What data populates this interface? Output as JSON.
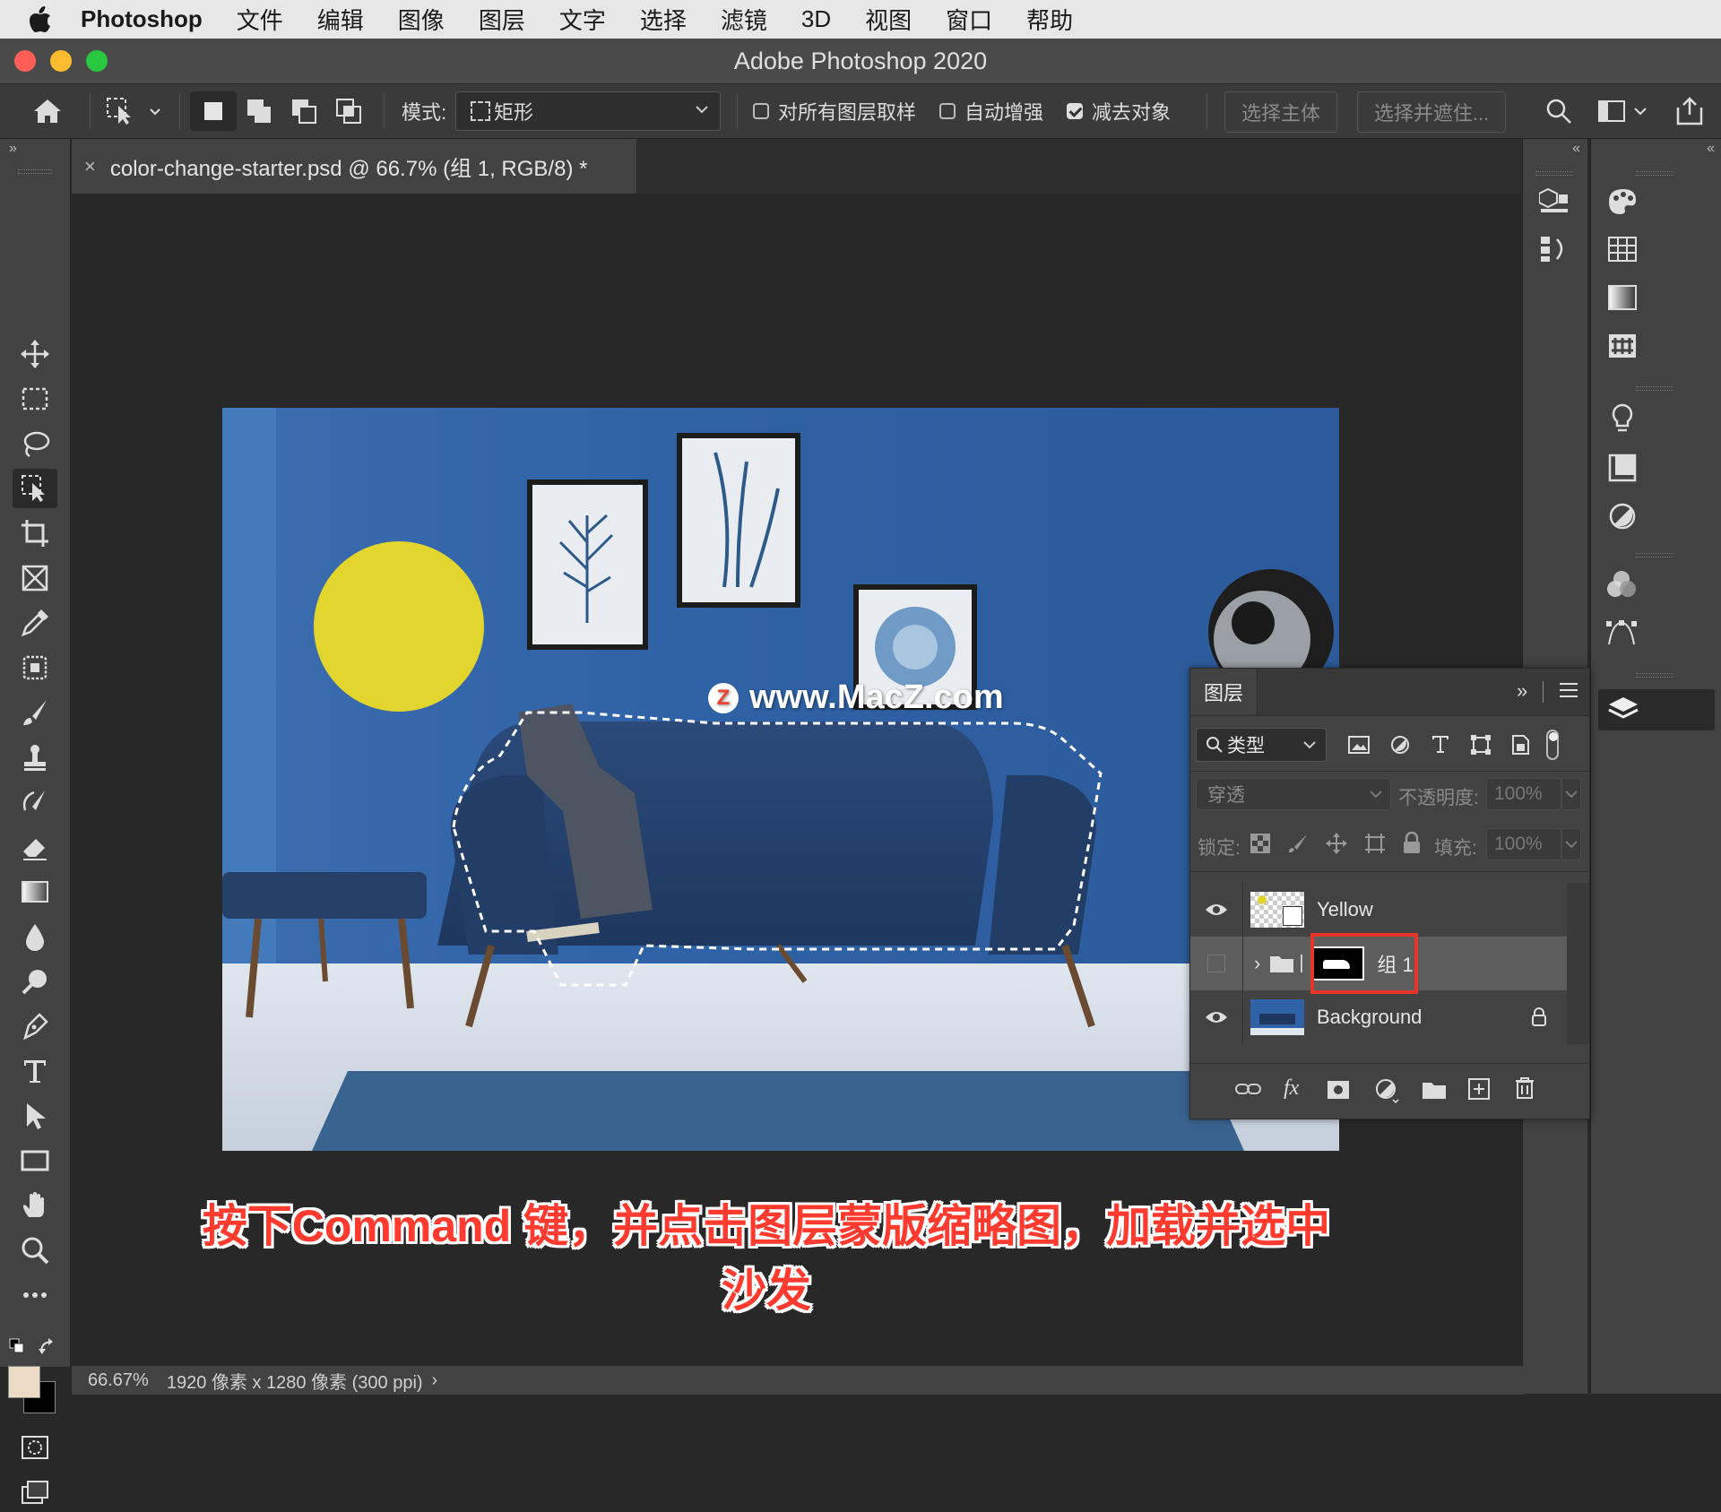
{
  "menubar": {
    "app_name": "Photoshop",
    "items": [
      "文件",
      "编辑",
      "图像",
      "图层",
      "文字",
      "选择",
      "滤镜",
      "3D",
      "视图",
      "窗口",
      "帮助"
    ]
  },
  "window": {
    "title": "Adobe Photoshop 2020"
  },
  "options_bar": {
    "mode_label": "模式:",
    "mode_value": "矩形",
    "sample_all_layers": "对所有图层取样",
    "sample_all_layers_checked": false,
    "auto_enhance": "自动增强",
    "auto_enhance_checked": false,
    "subtract_object": "减去对象",
    "subtract_object_checked": true,
    "select_subject": "选择主体",
    "select_and_mask": "选择并遮住..."
  },
  "document_tab": {
    "close": "×",
    "title": "color-change-starter.psd @ 66.7% (组 1, RGB/8) *"
  },
  "watermark": {
    "logo": "Z",
    "text": "www.MacZ.com"
  },
  "layers_panel": {
    "title": "图层",
    "filter_label": "类型",
    "blend_mode": "穿透",
    "opacity_label": "不透明度:",
    "opacity_value": "100%",
    "lock_label": "锁定:",
    "fill_label": "填充:",
    "fill_value": "100%",
    "layers": [
      {
        "name": "Yellow",
        "visible": true
      },
      {
        "name": "组 1",
        "visible": false,
        "selected": true
      },
      {
        "name": "Background",
        "visible": true,
        "locked": true
      }
    ],
    "footer_fx": "fx"
  },
  "status_bar": {
    "zoom": "66.67%",
    "doc_info": "1920 像素 x 1280 像素 (300 ppi)",
    "arrow": "›"
  },
  "caption": "按下Command 键，并点击图层蒙版缩略图，加载并选中沙发",
  "colors": {
    "foreground": "#ecdcc6",
    "background": "#000000",
    "highlight_box": "#e8352b",
    "caption": "#ff3b30"
  }
}
